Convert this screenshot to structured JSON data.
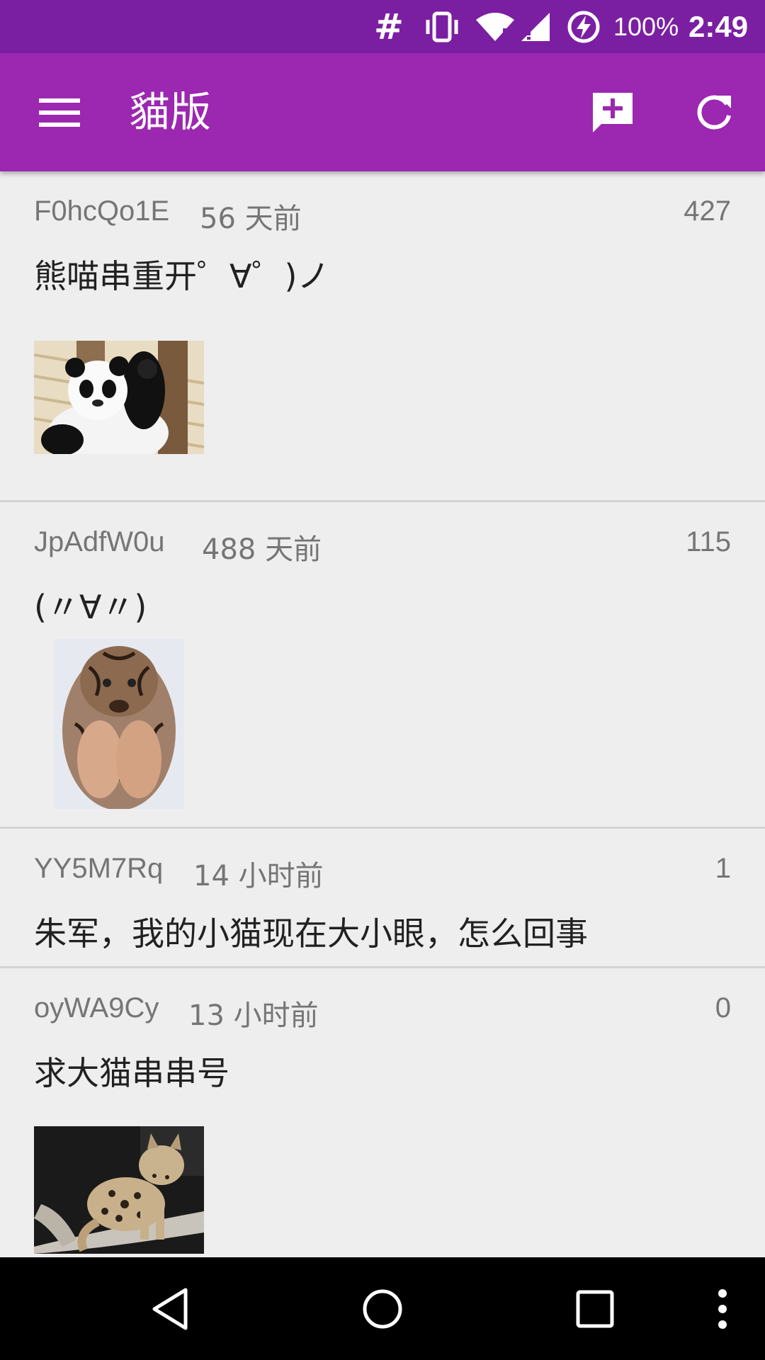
{
  "status_bar": {
    "hash_glyph": "#",
    "battery_text": "100%",
    "clock": "2:49",
    "icons": [
      "vibrate-icon",
      "wifi-icon",
      "signal-icon",
      "battery-charging-icon"
    ]
  },
  "app_bar": {
    "title": "貓版",
    "icons": [
      "menu-icon",
      "new-post-icon",
      "refresh-icon"
    ],
    "color": "#9c27b0"
  },
  "posts": [
    {
      "user": "F0hcQo1E",
      "time": "56 天前",
      "count": "427",
      "content": "熊喵串重开゜∀゜)ノ",
      "image": "panda-thumbnail"
    },
    {
      "user": "JpAdfW0u",
      "time": "488 天前",
      "count": "115",
      "content": "(〃∀〃)",
      "image": "tiger-thumbnail"
    },
    {
      "user": "YY5M7Rq",
      "time": "14 小时前",
      "count": "1",
      "content": "朱军，我的小猫现在大小眼，怎么回事",
      "image": null
    },
    {
      "user": "oyWA9Cy",
      "time": "13 小时前",
      "count": "0",
      "content": "求大猫串串号",
      "image": "ocelot-thumbnail"
    }
  ],
  "nav_bar": {
    "icons": [
      "back-icon",
      "home-icon",
      "recents-icon",
      "overflow-icon"
    ]
  }
}
